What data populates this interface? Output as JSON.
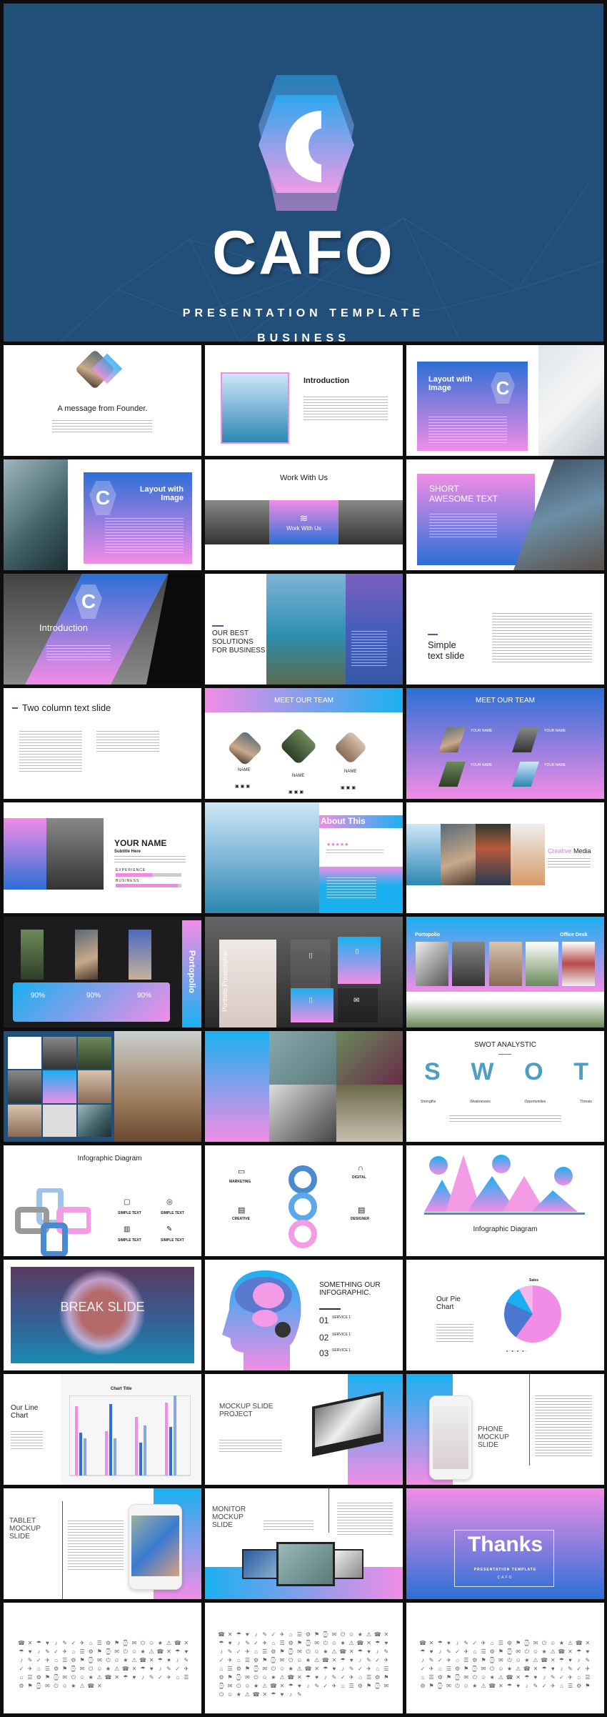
{
  "hero": {
    "title": "CAFO",
    "subtitle": "PRESENTATION TEMPLATE",
    "tagline": "BUSINESS",
    "logo_letter": "C"
  },
  "colors": {
    "background": "#224f7a",
    "pink": "#f18de6",
    "blue": "#2c6fd6",
    "cyan": "#1ab0f0"
  },
  "slides": {
    "founder": {
      "title": "A message from Founder."
    },
    "intro1": {
      "title": "Introduction"
    },
    "layout1": {
      "title": "Layout with Image",
      "logo_letter": "C"
    },
    "layout2": {
      "title": "Layout with Image",
      "logo_letter": "C"
    },
    "work": {
      "title": "Work With Us",
      "card_title": "Work With Us"
    },
    "short": {
      "title": "SHORT AWESOME TEXT"
    },
    "intro2": {
      "title": "Introduction",
      "logo_letter": "C"
    },
    "best": {
      "title": "OUR BEST SOLUTIONS FOR BUSINESS"
    },
    "simple": {
      "title": "Simple text slide"
    },
    "twocol": {
      "title": "Two column text slide"
    },
    "team1": {
      "title": "MEET OUR TEAM",
      "names": [
        "NAME",
        "NAME",
        "NAME"
      ]
    },
    "team2": {
      "title": "MEET OUR TEAM",
      "names": [
        "YOUR NAME",
        "YOUR NAME",
        "YOUR NAME",
        "YOUR NAME"
      ]
    },
    "profile": {
      "title": "YOUR NAME",
      "subtitle": "Subtitle Here",
      "skills": [
        {
          "label": "EXPERIENCE",
          "percent": 55
        },
        {
          "label": "BUSINESS",
          "percent": 95
        }
      ]
    },
    "about": {
      "title": "About This",
      "stars": "★★★★★"
    },
    "creative": {
      "title_a": "Creative",
      "title_b": "Media"
    },
    "portopolio": {
      "title": "Portopolio",
      "stats": [
        "90%",
        "90%",
        "90%"
      ]
    },
    "portfolio_pres": {
      "title": "Portfolio Presentation"
    },
    "office": {
      "left": "Portopolio",
      "right": "Office Desk"
    },
    "swot": {
      "title": "SWOT ANALYSTIC",
      "letters": [
        "S",
        "W",
        "O",
        "T"
      ],
      "labels": [
        "Strengths",
        "Weaknesses",
        "Opportunities",
        "Threats"
      ]
    },
    "info1": {
      "title": "Infographic Diagram",
      "items": [
        "SIMPLE TEXT",
        "SIMPLE TEXT",
        "SIMPLE TEXT",
        "SIMPLE TEXT"
      ]
    },
    "info2": {
      "items": [
        "MARKETING",
        "DIGITAL",
        "CREATIVE",
        "DESIGNER"
      ]
    },
    "info3": {
      "title": "Infographic Diagram"
    },
    "break": {
      "title": "BREAK SLIDE"
    },
    "brain": {
      "title": "SOMETHING OUR INFOGRAPHIC.",
      "services": [
        {
          "num": "01",
          "label": "SERVICE 1"
        },
        {
          "num": "02",
          "label": "SERVICE 1"
        },
        {
          "num": "03",
          "label": "SERVICE 1"
        }
      ]
    },
    "pie": {
      "title": "Our Pie Chart",
      "chart_title": "Sales"
    },
    "linechart": {
      "title": "Our Line Chart",
      "chart_title": "Chart Title"
    },
    "mockup": {
      "title": "MOCKUP SLIDE PROJECT"
    },
    "phone": {
      "title": "PHONE MOCKUP SLIDE"
    },
    "tablet": {
      "title": "TABLET MOCKUP SLIDE"
    },
    "monitor": {
      "title": "MONITOR MOCKUP SLIDE"
    },
    "thanks": {
      "title": "Thanks",
      "subtitle": "PRESENTATION TEMPLATE",
      "brand": "CAFO"
    }
  },
  "icons": [
    "☺",
    "⚙",
    "✎",
    "☎",
    "✉",
    "⌂",
    "♥",
    "★",
    "⚑",
    "✓",
    "✕",
    "⏻",
    "☰",
    "♪",
    "⚠",
    "⌚",
    "✈",
    "☂"
  ]
}
